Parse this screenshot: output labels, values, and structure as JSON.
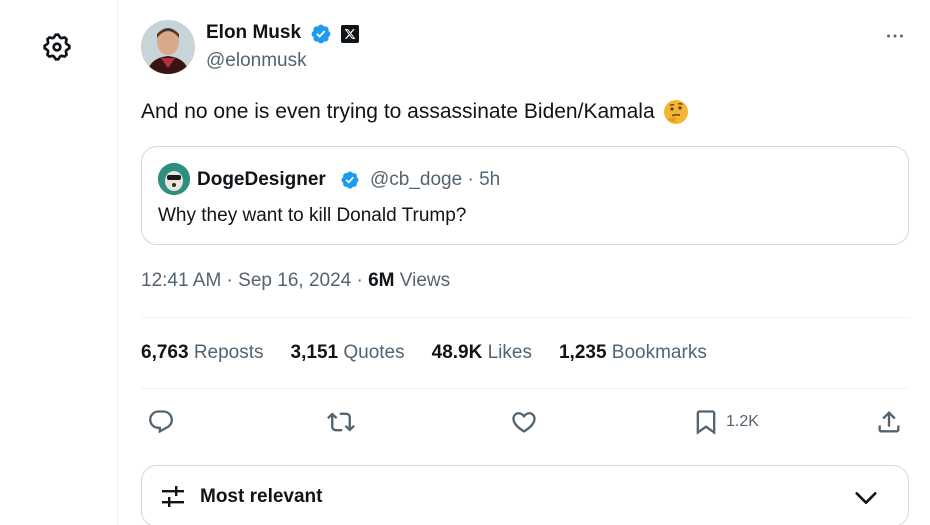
{
  "tweet": {
    "author_name": "Elon Musk",
    "author_handle": "@elonmusk",
    "text": "And no one is even trying to assassinate Biden/Kamala",
    "emoji": "thinking-face-emoji",
    "timestamp": "12:41 AM · Sep 16, 2024 · ",
    "views_count": "6M",
    "views_label": " Views"
  },
  "quote": {
    "author_name": "DogeDesigner",
    "meta": "@cb_doge · 5h",
    "text": "Why they want to kill Donald Trump?"
  },
  "stats": [
    {
      "num": "6,763",
      "label": " Reposts"
    },
    {
      "num": "3,151",
      "label": " Quotes"
    },
    {
      "num": "48.9K",
      "label": " Likes"
    },
    {
      "num": "1,235",
      "label": " Bookmarks"
    }
  ],
  "actions": {
    "bookmark_count": "1.2K",
    "icons": [
      "reply-icon",
      "repost-icon",
      "like-icon",
      "bookmark-icon",
      "share-icon"
    ]
  },
  "sort": {
    "label": "Most relevant"
  },
  "colors": {
    "text": "#0f1419",
    "secondary": "#536471",
    "border": "#cfd9de",
    "verified": "#1d9bf0"
  }
}
